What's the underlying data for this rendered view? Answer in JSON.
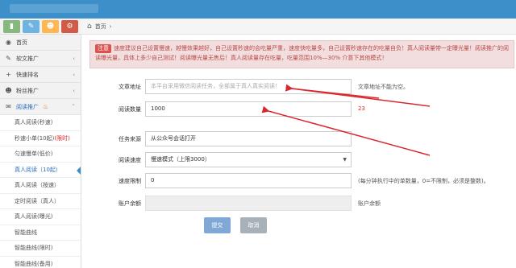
{
  "breadcrumb": {
    "home_label": "首页",
    "separator": "›"
  },
  "quick_buttons": [
    {
      "icon": "bar-chart-icon",
      "color": "#87b87f",
      "glyph": "▮"
    },
    {
      "icon": "pencil-icon",
      "color": "#6fb3e0",
      "glyph": "✎"
    },
    {
      "icon": "users-icon",
      "color": "#ffb752",
      "glyph": "☻"
    },
    {
      "icon": "cogs-icon",
      "color": "#d15b47",
      "glyph": "⚙"
    }
  ],
  "sidebar": {
    "items": [
      {
        "label": "首页",
        "icon": "dashboard-icon",
        "glyph": "◉"
      },
      {
        "label": "软文推广",
        "icon": "pencil-icon",
        "glyph": "✎",
        "arrow": "‹"
      },
      {
        "label": "快速排名",
        "icon": "plus-icon",
        "glyph": "+",
        "arrow": "‹"
      },
      {
        "label": "粉丝推广",
        "icon": "users-icon",
        "glyph": "☻",
        "arrow": "‹"
      },
      {
        "label": "阅读推广",
        "icon": "chat-icon",
        "glyph": "✉",
        "arrow": "˅"
      }
    ],
    "subitems": [
      "真人阅读(秒速)",
      "秒速小单(10起)",
      "匀速慢单(低价)",
      "真人阅读（10起）",
      "真人阅读（按速）",
      "定时阅读（真人）",
      "真人阅读(曝光)",
      "智能曲线",
      "智能曲线(限时)",
      "智能曲线(备用)"
    ],
    "sub_tag": "限时"
  },
  "notice": {
    "tag": "注意",
    "text": "速度建议自己设置慢速，越慢效果越好，自己设置秒速的会吃量严重，速度快吃量多，自己设置秒速存在的吃量自负！真人阅读量带一定曝光量！阅读推广的阅读曝光量，具体上多少自己测试！阅读曝光量无售后！真人阅读量存在吃量，吃量范围10%—30% 介意下其他模式！"
  },
  "form": {
    "url_label": "文章地址",
    "url_placeholder": "本平台采用微信阅读任务，全部属于真人真实阅读！",
    "url_hint": "文章地址不能为空。",
    "qty_label": "阅读数量",
    "qty_value": "1000",
    "qty_hint": "23",
    "source_label": "任务来源",
    "source_value": "从公众号会话打开",
    "speed_label": "阅读速度",
    "speed_value": "慢速模式（上限3000）",
    "limit_label": "速度限制",
    "limit_value": "0",
    "limit_hint": "(每分钟执行中的单数量，0=不限制，必须是整数)。",
    "balance_label": "账户余额",
    "balance_hint": "账户余额",
    "submit_label": "提交",
    "cancel_label": "取消"
  },
  "colors": {
    "topbar": "#3c8fc8",
    "annotation_red": "#d9272e",
    "notice_bg": "#f2dede"
  }
}
